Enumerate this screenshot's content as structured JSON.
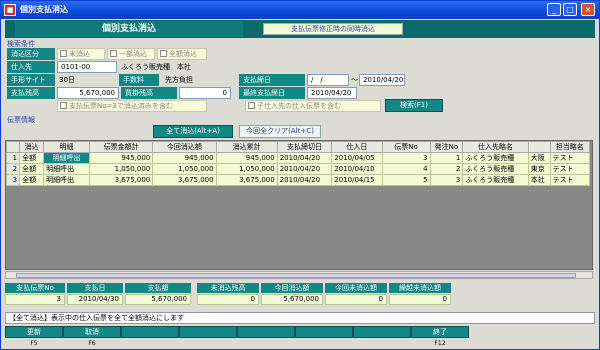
{
  "window": {
    "title": "個別支払消込"
  },
  "header": {
    "title": "個別支払消込",
    "notice": "支払伝票修正時の同時消込"
  },
  "search": {
    "group": "検索条件",
    "kubun_label": "消込区分",
    "check_options": [
      "未消込",
      "一部消込",
      "全額消込"
    ],
    "supplier_label": "仕入先",
    "supplier_code": "0101-00",
    "supplier_name": "ふくろう販売種　本社",
    "site_label": "手形サイト",
    "site_value": "30日",
    "fee_label": "手数料",
    "fee_value": "先方負担",
    "paydate_label": "支払締日",
    "paydate_from": "/　/",
    "tilde": "～",
    "paydate_to": "2010/04/20",
    "balance_label": "支払残高",
    "balance_value": "5,670,000",
    "buy_balance_label": "買掛残高",
    "buy_balance_value": "0",
    "last_label": "最終支払締日",
    "last_value": "2010/04/20",
    "opt1": "支払伝票No=3で消込済みを含む",
    "opt2": "子仕入先の仕入伝票を含む",
    "search_button": "検索(F1)"
  },
  "slip": {
    "group": "伝票情報",
    "all_button": "全て消込(Alt+A)",
    "clear_button": "今回全クリア(Alt+C)"
  },
  "table": {
    "columns": [
      "消込",
      "明細",
      "伝票金額計",
      "今回消込額",
      "消込累計",
      "支払締切日",
      "仕入日",
      "伝票No",
      "発注No",
      "仕入先略名",
      "",
      "担当略名"
    ],
    "rows": [
      {
        "no": "1",
        "kubun": "全額",
        "meisai": "明細呼出",
        "amount": "945,000",
        "now": "945,000",
        "cum": "945,000",
        "closing": "2010/04/20",
        "date": "2010/04/05",
        "slip": "3",
        "order": "1",
        "supplier": "ふくろう販売種",
        "area": "大阪",
        "staff": "テスト"
      },
      {
        "no": "2",
        "kubun": "全額",
        "meisai": "明細呼出",
        "amount": "1,050,000",
        "now": "1,050,000",
        "cum": "1,050,000",
        "closing": "2010/04/20",
        "date": "2010/04/10",
        "slip": "4",
        "order": "2",
        "supplier": "ふくろう販売種",
        "area": "東京",
        "staff": "テスト"
      },
      {
        "no": "3",
        "kubun": "全額",
        "meisai": "明細呼出",
        "amount": "3,675,000",
        "now": "3,675,000",
        "cum": "3,675,000",
        "closing": "2010/04/20",
        "date": "2010/04/15",
        "slip": "5",
        "order": "3",
        "supplier": "ふくろう販売種",
        "area": "本社",
        "staff": "テスト"
      }
    ]
  },
  "summary": {
    "pay_no_label": "支払伝票No",
    "pay_no": "3",
    "pay_date_label": "支払日",
    "pay_date": "2010/04/30",
    "pay_amount_label": "支払額",
    "pay_amount": "5,670,000",
    "unpaid_label": "未消込残高",
    "unpaid": "0",
    "now_label": "今回消込額",
    "now": "5,670,000",
    "now_unpaid_label": "今回未消込額",
    "now_unpaid": "0",
    "carry_label": "繰越未消込額",
    "carry": "0"
  },
  "status": "【全て消込】表示中の仕入伝票を全て全額消込にします",
  "fkeys": {
    "f5": "更新",
    "f5_key": "F5",
    "f6": "取消",
    "f6_key": "F6",
    "f12": "終了",
    "f12_key": "F12"
  }
}
